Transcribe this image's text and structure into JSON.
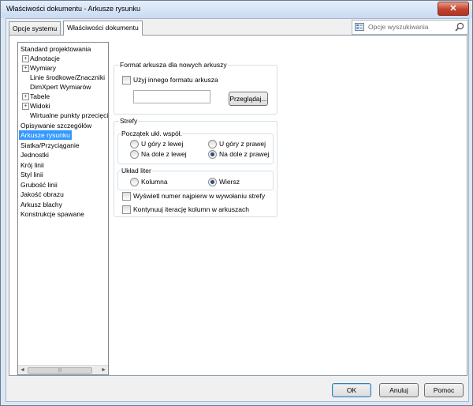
{
  "window": {
    "title": "Właściwości dokumentu - Arkusze rysunku",
    "close_glyph": "✕"
  },
  "tabs": [
    {
      "label": "Opcje systemu"
    },
    {
      "label": "Właściwości dokumentu"
    }
  ],
  "search": {
    "placeholder": "Opcje wyszukiwania"
  },
  "tree": [
    {
      "label": "Standard projektowania",
      "expander": ""
    },
    {
      "label": "Adnotacje",
      "expander": "+"
    },
    {
      "label": "Wymiary",
      "expander": "+"
    },
    {
      "label": "Linie środkowe/Znaczniki",
      "expander": ""
    },
    {
      "label": "DimXpert Wymiarów",
      "expander": ""
    },
    {
      "label": "Tabele",
      "expander": "+"
    },
    {
      "label": "Widoki",
      "expander": "+"
    },
    {
      "label": "Wirtualne punkty przecięcia",
      "expander": ""
    },
    {
      "label": "Opisywanie szczegółów",
      "expander": ""
    },
    {
      "label": "Arkusze rysunku",
      "expander": "",
      "selected": true
    },
    {
      "label": "Siatka/Przyciąganie",
      "expander": ""
    },
    {
      "label": "Jednostki",
      "expander": ""
    },
    {
      "label": "Krój linii",
      "expander": ""
    },
    {
      "label": "Styl linii",
      "expander": ""
    },
    {
      "label": "Grubość linii",
      "expander": ""
    },
    {
      "label": "Jakość obrazu",
      "expander": ""
    },
    {
      "label": "Arkusz blachy",
      "expander": ""
    },
    {
      "label": "Konstrukcje spawane",
      "expander": ""
    }
  ],
  "tree_scroll": {
    "left_arrow": "◄",
    "right_arrow": "►",
    "thumb_grip": "|||"
  },
  "sheet_format": {
    "group_title": "Format arkusza dla nowych arkuszy",
    "use_other_label": "Użyj innego formatu arkusza",
    "use_other_checked": false,
    "path_value": "",
    "browse_label": "Przeglądaj..."
  },
  "zones": {
    "group_title": "Strefy",
    "origin_title": "Początek ukł. współ.",
    "origin_options": [
      {
        "label": "U góry z lewej",
        "checked": false
      },
      {
        "label": "U góry z prawej",
        "checked": false
      },
      {
        "label": "Na dole z lewej",
        "checked": false
      },
      {
        "label": "Na dole z prawej",
        "checked": true
      }
    ],
    "letter_layout_title": "Układ liter",
    "letter_layout_options": [
      {
        "label": "Kolumna",
        "checked": false
      },
      {
        "label": "Wiersz",
        "checked": true
      }
    ],
    "show_number_first_label": "Wyświetl numer najpierw w wywołaniu strefy",
    "show_number_first_checked": false,
    "continue_iteration_label": "Kontynuuj iterację kolumn w arkuszach",
    "continue_iteration_checked": false
  },
  "footer": {
    "ok_label": "OK",
    "cancel_label": "Anuluj",
    "help_label": "Pomoc"
  },
  "colors": {
    "selection": "#3399ff",
    "title_bar": "#c9dbf1",
    "close_button": "#c1432e"
  }
}
